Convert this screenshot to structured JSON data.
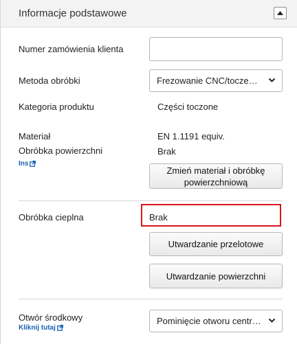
{
  "section": {
    "title": "Informacje podstawowe",
    "collapse_icon": "triangle-up-icon"
  },
  "order_number": {
    "label": "Numer zamówienia klienta",
    "value": "",
    "placeholder": ""
  },
  "machining_method": {
    "label": "Metoda obróbki",
    "selected": "Frezowanie CNC/toczenie CNC"
  },
  "product_category": {
    "label": "Kategoria produktu",
    "value": "Części toczone"
  },
  "material": {
    "label": "Materiał",
    "value": "EN 1.1191 equiv."
  },
  "surface_treatment": {
    "label": "Obróbka powierzchni",
    "value": "Brak",
    "link_label": "Ins",
    "change_button_label": "Zmień materiał i obróbkę powierzchniową"
  },
  "heat_treatment": {
    "label": "Obróbka cieplna",
    "value": "Brak",
    "through_hardening_button": "Utwardzanie przelotowe",
    "surface_hardening_button": "Utwardzanie powierzchni"
  },
  "center_hole": {
    "label": "Otwór środkowy",
    "link_label": "Kliknij tutaj",
    "selected": "Pominięcie otworu centralnego"
  },
  "colors": {
    "highlight": "#d9141b",
    "link": "#1a5fb4",
    "header_bg": "#f3f3f3"
  }
}
